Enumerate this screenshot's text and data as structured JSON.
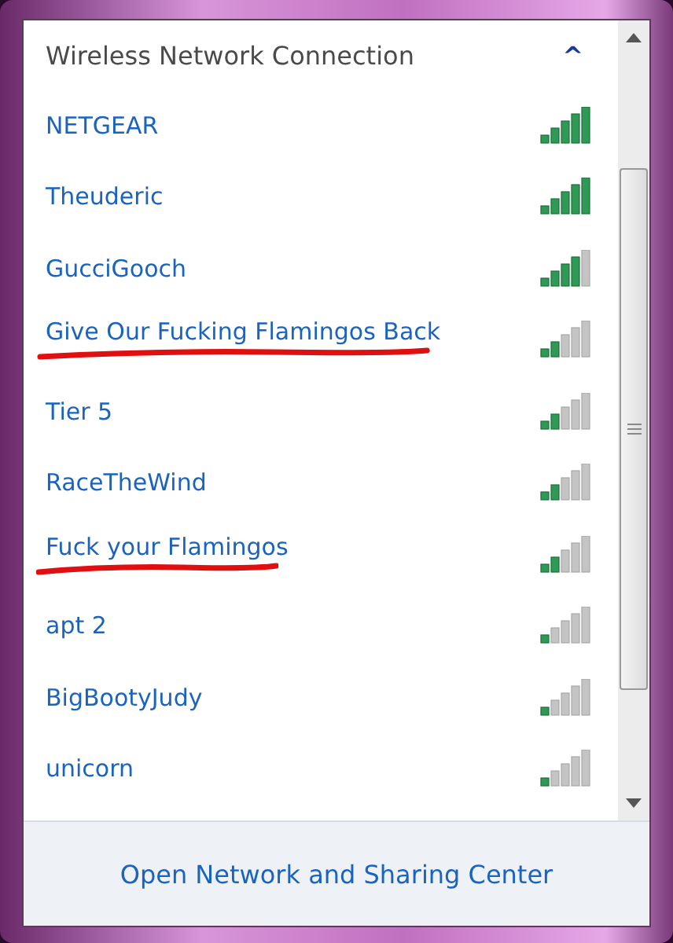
{
  "panel": {
    "title": "Wireless Network Connection",
    "collapse_icon": "^"
  },
  "networks": [
    {
      "name": "NETGEAR",
      "kind": "full",
      "underlined": false
    },
    {
      "name": "Theuderic",
      "kind": "full",
      "underlined": false
    },
    {
      "name": "GucciGooch",
      "kind": "good",
      "underlined": false
    },
    {
      "name": "Give Our Fucking Flamingos Back",
      "kind": "low",
      "underlined": true
    },
    {
      "name": "Tier 5",
      "kind": "low",
      "underlined": false
    },
    {
      "name": "RaceTheWind",
      "kind": "low",
      "underlined": false
    },
    {
      "name": "Fuck your Flamingos",
      "kind": "low",
      "underlined": true
    },
    {
      "name": "apt 2",
      "kind": "weak",
      "underlined": false
    },
    {
      "name": "BigBootyJudy",
      "kind": "weak",
      "underlined": false
    },
    {
      "name": "unicorn",
      "kind": "weak",
      "underlined": false
    }
  ],
  "footer": {
    "link": "Open Network and Sharing Center"
  }
}
